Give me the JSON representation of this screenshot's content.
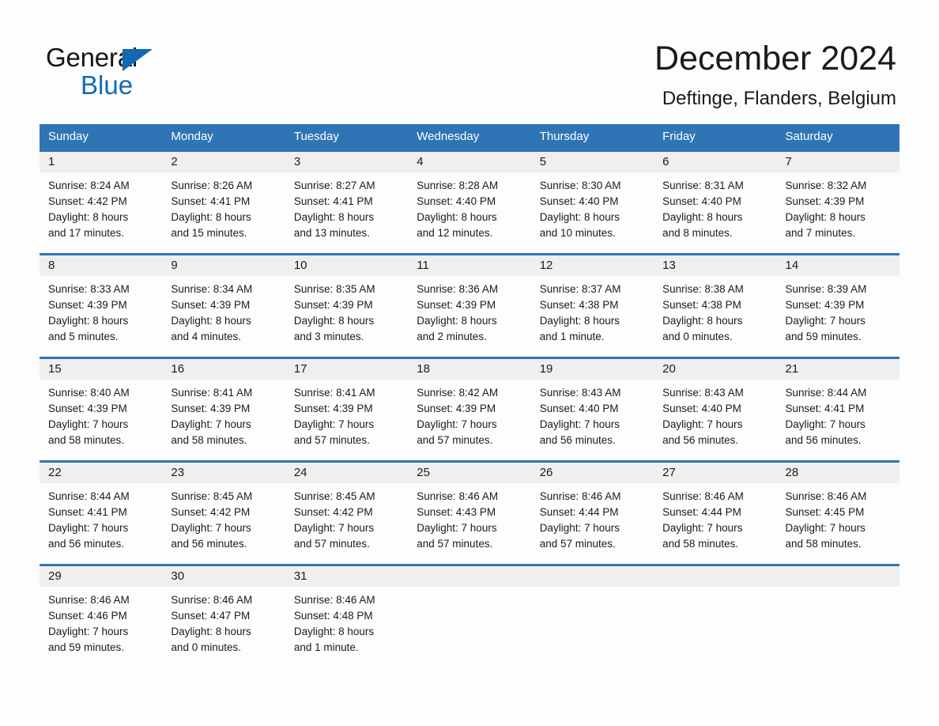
{
  "logo": {
    "line1": "General",
    "line2": "Blue",
    "triangle_color": "#1268b3",
    "text_color": "#161616"
  },
  "header": {
    "month_title": "December 2024",
    "location": "Deftinge, Flanders, Belgium"
  },
  "theme": {
    "header_blue": "#2f75b5",
    "row_divider_blue": "#2f75b5",
    "date_band_gray": "#efefef",
    "page_background": "#fdfdfd",
    "text_color": "#1b1b1b"
  },
  "calendar": {
    "day_names": [
      "Sunday",
      "Monday",
      "Tuesday",
      "Wednesday",
      "Thursday",
      "Friday",
      "Saturday"
    ],
    "weeks": [
      [
        {
          "day": "1",
          "sunrise": "Sunrise: 8:24 AM",
          "sunset": "Sunset: 4:42 PM",
          "daylight_line1": "Daylight: 8 hours",
          "daylight_line2": "and 17 minutes."
        },
        {
          "day": "2",
          "sunrise": "Sunrise: 8:26 AM",
          "sunset": "Sunset: 4:41 PM",
          "daylight_line1": "Daylight: 8 hours",
          "daylight_line2": "and 15 minutes."
        },
        {
          "day": "3",
          "sunrise": "Sunrise: 8:27 AM",
          "sunset": "Sunset: 4:41 PM",
          "daylight_line1": "Daylight: 8 hours",
          "daylight_line2": "and 13 minutes."
        },
        {
          "day": "4",
          "sunrise": "Sunrise: 8:28 AM",
          "sunset": "Sunset: 4:40 PM",
          "daylight_line1": "Daylight: 8 hours",
          "daylight_line2": "and 12 minutes."
        },
        {
          "day": "5",
          "sunrise": "Sunrise: 8:30 AM",
          "sunset": "Sunset: 4:40 PM",
          "daylight_line1": "Daylight: 8 hours",
          "daylight_line2": "and 10 minutes."
        },
        {
          "day": "6",
          "sunrise": "Sunrise: 8:31 AM",
          "sunset": "Sunset: 4:40 PM",
          "daylight_line1": "Daylight: 8 hours",
          "daylight_line2": "and 8 minutes."
        },
        {
          "day": "7",
          "sunrise": "Sunrise: 8:32 AM",
          "sunset": "Sunset: 4:39 PM",
          "daylight_line1": "Daylight: 8 hours",
          "daylight_line2": "and 7 minutes."
        }
      ],
      [
        {
          "day": "8",
          "sunrise": "Sunrise: 8:33 AM",
          "sunset": "Sunset: 4:39 PM",
          "daylight_line1": "Daylight: 8 hours",
          "daylight_line2": "and 5 minutes."
        },
        {
          "day": "9",
          "sunrise": "Sunrise: 8:34 AM",
          "sunset": "Sunset: 4:39 PM",
          "daylight_line1": "Daylight: 8 hours",
          "daylight_line2": "and 4 minutes."
        },
        {
          "day": "10",
          "sunrise": "Sunrise: 8:35 AM",
          "sunset": "Sunset: 4:39 PM",
          "daylight_line1": "Daylight: 8 hours",
          "daylight_line2": "and 3 minutes."
        },
        {
          "day": "11",
          "sunrise": "Sunrise: 8:36 AM",
          "sunset": "Sunset: 4:39 PM",
          "daylight_line1": "Daylight: 8 hours",
          "daylight_line2": "and 2 minutes."
        },
        {
          "day": "12",
          "sunrise": "Sunrise: 8:37 AM",
          "sunset": "Sunset: 4:38 PM",
          "daylight_line1": "Daylight: 8 hours",
          "daylight_line2": "and 1 minute."
        },
        {
          "day": "13",
          "sunrise": "Sunrise: 8:38 AM",
          "sunset": "Sunset: 4:38 PM",
          "daylight_line1": "Daylight: 8 hours",
          "daylight_line2": "and 0 minutes."
        },
        {
          "day": "14",
          "sunrise": "Sunrise: 8:39 AM",
          "sunset": "Sunset: 4:39 PM",
          "daylight_line1": "Daylight: 7 hours",
          "daylight_line2": "and 59 minutes."
        }
      ],
      [
        {
          "day": "15",
          "sunrise": "Sunrise: 8:40 AM",
          "sunset": "Sunset: 4:39 PM",
          "daylight_line1": "Daylight: 7 hours",
          "daylight_line2": "and 58 minutes."
        },
        {
          "day": "16",
          "sunrise": "Sunrise: 8:41 AM",
          "sunset": "Sunset: 4:39 PM",
          "daylight_line1": "Daylight: 7 hours",
          "daylight_line2": "and 58 minutes."
        },
        {
          "day": "17",
          "sunrise": "Sunrise: 8:41 AM",
          "sunset": "Sunset: 4:39 PM",
          "daylight_line1": "Daylight: 7 hours",
          "daylight_line2": "and 57 minutes."
        },
        {
          "day": "18",
          "sunrise": "Sunrise: 8:42 AM",
          "sunset": "Sunset: 4:39 PM",
          "daylight_line1": "Daylight: 7 hours",
          "daylight_line2": "and 57 minutes."
        },
        {
          "day": "19",
          "sunrise": "Sunrise: 8:43 AM",
          "sunset": "Sunset: 4:40 PM",
          "daylight_line1": "Daylight: 7 hours",
          "daylight_line2": "and 56 minutes."
        },
        {
          "day": "20",
          "sunrise": "Sunrise: 8:43 AM",
          "sunset": "Sunset: 4:40 PM",
          "daylight_line1": "Daylight: 7 hours",
          "daylight_line2": "and 56 minutes."
        },
        {
          "day": "21",
          "sunrise": "Sunrise: 8:44 AM",
          "sunset": "Sunset: 4:41 PM",
          "daylight_line1": "Daylight: 7 hours",
          "daylight_line2": "and 56 minutes."
        }
      ],
      [
        {
          "day": "22",
          "sunrise": "Sunrise: 8:44 AM",
          "sunset": "Sunset: 4:41 PM",
          "daylight_line1": "Daylight: 7 hours",
          "daylight_line2": "and 56 minutes."
        },
        {
          "day": "23",
          "sunrise": "Sunrise: 8:45 AM",
          "sunset": "Sunset: 4:42 PM",
          "daylight_line1": "Daylight: 7 hours",
          "daylight_line2": "and 56 minutes."
        },
        {
          "day": "24",
          "sunrise": "Sunrise: 8:45 AM",
          "sunset": "Sunset: 4:42 PM",
          "daylight_line1": "Daylight: 7 hours",
          "daylight_line2": "and 57 minutes."
        },
        {
          "day": "25",
          "sunrise": "Sunrise: 8:46 AM",
          "sunset": "Sunset: 4:43 PM",
          "daylight_line1": "Daylight: 7 hours",
          "daylight_line2": "and 57 minutes."
        },
        {
          "day": "26",
          "sunrise": "Sunrise: 8:46 AM",
          "sunset": "Sunset: 4:44 PM",
          "daylight_line1": "Daylight: 7 hours",
          "daylight_line2": "and 57 minutes."
        },
        {
          "day": "27",
          "sunrise": "Sunrise: 8:46 AM",
          "sunset": "Sunset: 4:44 PM",
          "daylight_line1": "Daylight: 7 hours",
          "daylight_line2": "and 58 minutes."
        },
        {
          "day": "28",
          "sunrise": "Sunrise: 8:46 AM",
          "sunset": "Sunset: 4:45 PM",
          "daylight_line1": "Daylight: 7 hours",
          "daylight_line2": "and 58 minutes."
        }
      ],
      [
        {
          "day": "29",
          "sunrise": "Sunrise: 8:46 AM",
          "sunset": "Sunset: 4:46 PM",
          "daylight_line1": "Daylight: 7 hours",
          "daylight_line2": "and 59 minutes."
        },
        {
          "day": "30",
          "sunrise": "Sunrise: 8:46 AM",
          "sunset": "Sunset: 4:47 PM",
          "daylight_line1": "Daylight: 8 hours",
          "daylight_line2": "and 0 minutes."
        },
        {
          "day": "31",
          "sunrise": "Sunrise: 8:46 AM",
          "sunset": "Sunset: 4:48 PM",
          "daylight_line1": "Daylight: 8 hours",
          "daylight_line2": "and 1 minute."
        },
        {
          "day": "",
          "sunrise": "",
          "sunset": "",
          "daylight_line1": "",
          "daylight_line2": ""
        },
        {
          "day": "",
          "sunrise": "",
          "sunset": "",
          "daylight_line1": "",
          "daylight_line2": ""
        },
        {
          "day": "",
          "sunrise": "",
          "sunset": "",
          "daylight_line1": "",
          "daylight_line2": ""
        },
        {
          "day": "",
          "sunrise": "",
          "sunset": "",
          "daylight_line1": "",
          "daylight_line2": ""
        }
      ]
    ]
  }
}
